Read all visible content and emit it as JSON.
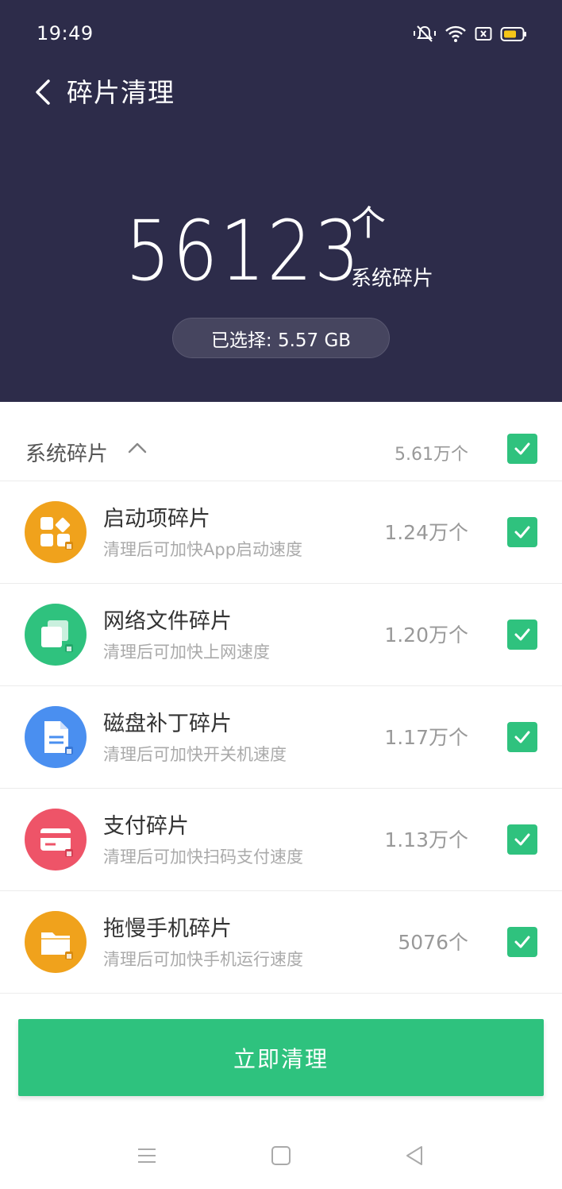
{
  "status_bar": {
    "time": "19:49",
    "icons": [
      "mute-vibrate-icon",
      "wifi-icon",
      "sim-icon",
      "battery-icon"
    ]
  },
  "header": {
    "title": "碎片清理",
    "count": "56123",
    "count_unit": "个",
    "count_label": "系统碎片",
    "selected": "已选择: 5.57 GB",
    "background": "#2d2c4a"
  },
  "group": {
    "title": "系统碎片",
    "count": "5.61万个",
    "checked": true
  },
  "items": [
    {
      "title": "启动项碎片",
      "desc": "清理后可加快App启动速度",
      "count": "1.24万个",
      "icon": "apps-grid-icon",
      "color": "#f0a21c",
      "checked": true
    },
    {
      "title": "网络文件碎片",
      "desc": "清理后可加快上网速度",
      "count": "1.20万个",
      "icon": "network-files-icon",
      "color": "#2fc27e",
      "checked": true
    },
    {
      "title": "磁盘补丁碎片",
      "desc": "清理后可加快开关机速度",
      "count": "1.17万个",
      "icon": "document-icon",
      "color": "#4a8ff0",
      "checked": true
    },
    {
      "title": "支付碎片",
      "desc": "清理后可加快扫码支付速度",
      "count": "1.13万个",
      "icon": "payment-card-icon",
      "color": "#ee5468",
      "checked": true
    },
    {
      "title": "拖慢手机碎片",
      "desc": "清理后可加快手机运行速度",
      "count": "5076个",
      "icon": "folder-icon",
      "color": "#f0a21c",
      "checked": true
    }
  ],
  "action": {
    "clean_label": "立即清理",
    "color": "#2ec27e"
  },
  "nav_bar": [
    "menu-icon",
    "home-icon",
    "back-triangle-icon"
  ]
}
